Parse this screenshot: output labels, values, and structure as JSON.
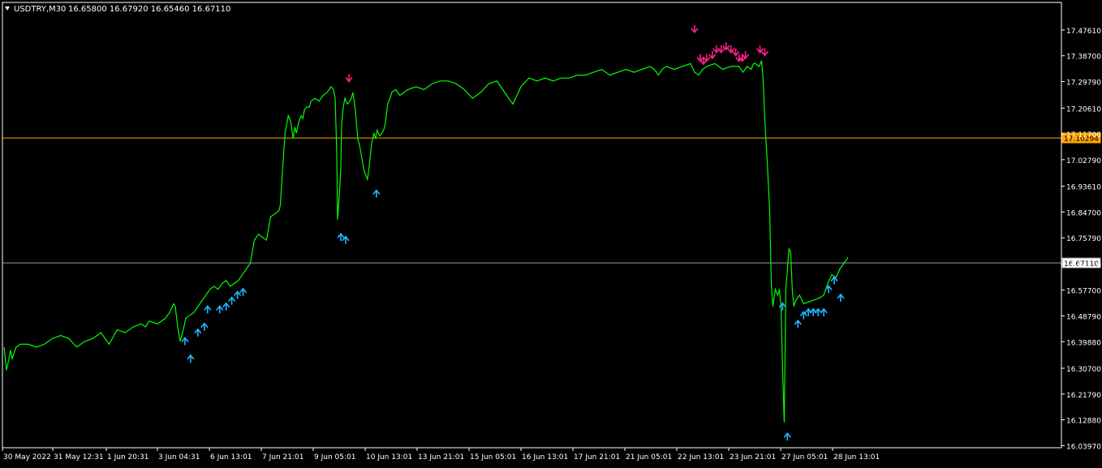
{
  "header": {
    "symbol_timeframe": "USDTRY,M30",
    "ohlc": "16.65800 16.67920 16.65460 16.67110"
  },
  "colors": {
    "background": "#000000",
    "price_line": "#00ff00",
    "axis": "#ffffff",
    "text": "#ffffff",
    "buy_arrow": "#1fb7ff",
    "sell_arrow": "#ff1f8a",
    "level_line": "#ffa500",
    "bid_line": "#a0a0a0"
  },
  "chart_data": {
    "type": "line",
    "ylim": [
      16.0379,
      17.5152
    ],
    "y_ticks": [
      "17.47610",
      "17.38700",
      "17.29790",
      "17.20610",
      "17.11700",
      "17.02790",
      "16.93610",
      "16.84700",
      "16.75790",
      "16.66610",
      "16.57700",
      "16.48790",
      "16.39880",
      "16.30700",
      "16.21790",
      "16.12880",
      "16.03970"
    ],
    "x_ticks": [
      "30 May 2022",
      "31 May 12:31",
      "1 Jun 20:31",
      "3 Jun 04:31",
      "6 Jun 13:01",
      "7 Jun 21:01",
      "9 Jun 05:01",
      "10 Jun 13:01",
      "13 Jun 21:01",
      "15 Jun 05:01",
      "16 Jun 13:01",
      "17 Jun 21:01",
      "21 Jun 05:01",
      "22 Jun 13:01",
      "23 Jun 21:01",
      "27 Jun 05:01",
      "28 Jun 13:01"
    ],
    "level_line": {
      "value": 17.10294,
      "label": "17.10294"
    },
    "bid_line": {
      "value": 16.6711,
      "label": "16.67110"
    },
    "x": [
      0,
      3,
      6,
      8,
      10,
      15,
      20,
      30,
      40,
      50,
      55,
      60,
      70,
      80,
      90,
      100,
      110,
      120,
      130,
      140,
      150,
      160,
      170,
      175,
      180,
      190,
      200,
      205,
      210,
      212,
      215,
      218,
      220,
      222,
      225,
      230,
      235,
      240,
      245,
      250,
      255,
      260,
      265,
      270,
      275,
      280,
      285,
      290,
      295,
      300,
      305,
      310,
      315,
      320,
      325,
      330,
      335,
      340,
      342,
      345,
      348,
      350,
      352,
      355,
      358,
      360,
      362,
      365,
      368,
      370,
      372,
      375,
      378,
      380,
      385,
      390,
      395,
      400,
      405,
      408,
      410,
      412,
      413,
      415,
      417,
      418,
      420,
      422,
      425,
      428,
      430,
      432,
      435,
      438,
      440,
      442,
      445,
      447,
      450,
      452,
      455,
      458,
      460,
      462,
      465,
      468,
      470,
      472,
      475,
      478,
      480,
      485,
      490,
      500,
      510,
      520,
      530,
      540,
      550,
      560,
      570,
      580,
      590,
      600,
      610,
      615,
      620,
      625,
      630,
      640,
      650,
      660,
      670,
      680,
      690,
      700,
      710,
      720,
      730,
      740,
      750,
      760,
      770,
      780,
      790,
      800,
      805,
      808,
      810,
      815,
      820,
      830,
      840,
      850,
      855,
      860,
      865,
      870,
      880,
      890,
      900,
      910,
      915,
      920,
      925,
      928,
      930,
      935,
      938,
      940,
      942,
      945,
      948,
      950,
      952,
      955,
      958,
      960,
      962,
      964,
      966,
      968,
      970,
      972,
      974,
      976,
      978,
      980,
      985,
      990,
      1000,
      1010,
      1015,
      1020,
      1025,
      1030,
      1035,
      1040,
      1045
    ],
    "y": [
      16.38,
      16.3,
      16.34,
      16.37,
      16.34,
      16.38,
      16.39,
      16.39,
      16.38,
      16.39,
      16.4,
      16.41,
      16.42,
      16.41,
      16.38,
      16.4,
      16.41,
      16.43,
      16.39,
      16.44,
      16.43,
      16.45,
      16.46,
      16.45,
      16.47,
      16.46,
      16.48,
      16.5,
      16.53,
      16.52,
      16.45,
      16.4,
      16.42,
      16.44,
      16.48,
      16.49,
      16.5,
      16.52,
      16.54,
      16.56,
      16.58,
      16.59,
      16.58,
      16.6,
      16.61,
      16.59,
      16.6,
      16.61,
      16.63,
      16.65,
      16.67,
      16.75,
      16.77,
      16.76,
      16.75,
      16.83,
      16.84,
      16.85,
      16.87,
      17.0,
      17.12,
      17.15,
      17.18,
      17.16,
      17.1,
      17.14,
      17.12,
      17.16,
      17.18,
      17.17,
      17.2,
      17.21,
      17.21,
      17.23,
      17.24,
      17.23,
      17.25,
      17.26,
      17.28,
      17.27,
      17.24,
      17.05,
      16.82,
      16.9,
      17.0,
      17.15,
      17.21,
      17.24,
      17.22,
      17.23,
      17.24,
      17.26,
      17.2,
      17.1,
      17.08,
      17.05,
      17.0,
      16.98,
      16.96,
      17.0,
      17.08,
      17.12,
      17.1,
      17.13,
      17.11,
      17.12,
      17.13,
      17.15,
      17.22,
      17.24,
      17.26,
      17.27,
      17.25,
      17.27,
      17.28,
      17.27,
      17.29,
      17.3,
      17.3,
      17.29,
      17.27,
      17.24,
      17.26,
      17.29,
      17.3,
      17.28,
      17.26,
      17.24,
      17.22,
      17.28,
      17.31,
      17.3,
      17.31,
      17.3,
      17.31,
      17.31,
      17.32,
      17.32,
      17.33,
      17.34,
      17.32,
      17.33,
      17.34,
      17.33,
      17.34,
      17.35,
      17.34,
      17.33,
      17.32,
      17.34,
      17.35,
      17.34,
      17.35,
      17.36,
      17.33,
      17.32,
      17.34,
      17.35,
      17.36,
      17.34,
      17.35,
      17.35,
      17.33,
      17.35,
      17.34,
      17.36,
      17.36,
      17.35,
      17.37,
      17.3,
      17.16,
      17.02,
      16.85,
      16.6,
      16.52,
      16.58,
      16.56,
      16.58,
      16.52,
      16.3,
      16.12,
      16.58,
      16.65,
      16.72,
      16.71,
      16.58,
      16.52,
      16.54,
      16.56,
      16.53,
      16.54,
      16.55,
      16.56,
      16.6,
      16.63,
      16.62,
      16.65,
      16.67,
      16.69,
      16.67,
      16.67
    ],
    "buy_signals": [
      {
        "x": 224,
        "y": 16.44
      },
      {
        "x": 231,
        "y": 16.38
      },
      {
        "x": 240,
        "y": 16.47
      },
      {
        "x": 248,
        "y": 16.49
      },
      {
        "x": 252,
        "y": 16.55
      },
      {
        "x": 267,
        "y": 16.55
      },
      {
        "x": 275,
        "y": 16.56
      },
      {
        "x": 282,
        "y": 16.58
      },
      {
        "x": 289,
        "y": 16.6
      },
      {
        "x": 296,
        "y": 16.61
      },
      {
        "x": 417,
        "y": 16.8
      },
      {
        "x": 423,
        "y": 16.79
      },
      {
        "x": 461,
        "y": 16.95
      },
      {
        "x": 964,
        "y": 16.56
      },
      {
        "x": 970,
        "y": 16.11
      },
      {
        "x": 983,
        "y": 16.5
      },
      {
        "x": 990,
        "y": 16.53
      },
      {
        "x": 996,
        "y": 16.54
      },
      {
        "x": 1002,
        "y": 16.54
      },
      {
        "x": 1008,
        "y": 16.54
      },
      {
        "x": 1015,
        "y": 16.54
      },
      {
        "x": 1021,
        "y": 16.62
      },
      {
        "x": 1028,
        "y": 16.65
      },
      {
        "x": 1036,
        "y": 16.59
      }
    ],
    "sell_signals": [
      {
        "x": 427,
        "y": 17.27
      },
      {
        "x": 855,
        "y": 17.44
      },
      {
        "x": 862,
        "y": 17.34
      },
      {
        "x": 866,
        "y": 17.33
      },
      {
        "x": 870,
        "y": 17.34
      },
      {
        "x": 877,
        "y": 17.35
      },
      {
        "x": 882,
        "y": 17.37
      },
      {
        "x": 888,
        "y": 17.37
      },
      {
        "x": 894,
        "y": 17.38
      },
      {
        "x": 900,
        "y": 17.37
      },
      {
        "x": 906,
        "y": 17.36
      },
      {
        "x": 910,
        "y": 17.34
      },
      {
        "x": 914,
        "y": 17.34
      },
      {
        "x": 918,
        "y": 17.35
      },
      {
        "x": 936,
        "y": 17.37
      },
      {
        "x": 942,
        "y": 17.36
      }
    ]
  }
}
